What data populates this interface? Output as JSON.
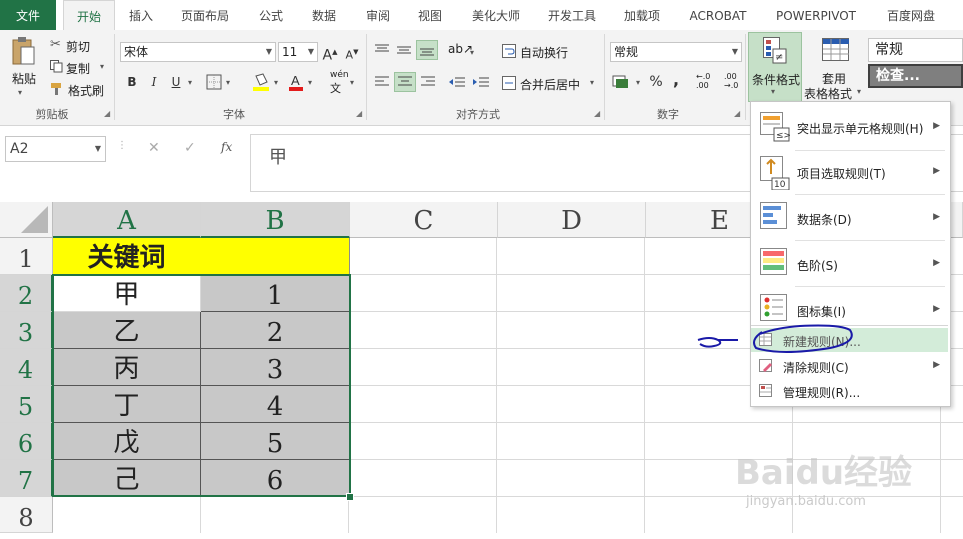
{
  "tabs": {
    "file": "文件",
    "home": "开始",
    "insert": "插入",
    "layout": "页面布局",
    "formulas": "公式",
    "data": "数据",
    "review": "审阅",
    "view": "视图",
    "beautify": "美化大师",
    "developer": "开发工具",
    "addins": "加载项",
    "acrobat": "ACROBAT",
    "powerpivot": "POWERPIVOT",
    "baidu": "百度网盘"
  },
  "clipboard": {
    "paste": "粘贴",
    "cut": "剪切",
    "copy": "复制",
    "format_painter": "格式刷",
    "group": "剪贴板"
  },
  "font": {
    "name": "宋体",
    "size": "11",
    "bold": "B",
    "italic": "I",
    "underline": "U",
    "phonetic": "wén",
    "group": "字体",
    "grow": "A",
    "shrink": "A"
  },
  "alignment": {
    "wrap": "自动换行",
    "merge": "合并后居中",
    "group": "对齐方式"
  },
  "number": {
    "format": "常规",
    "percent": "%",
    "comma": ",",
    "group": "数字",
    "inc": ".00",
    "dec": ".0"
  },
  "styles": {
    "cond_format": "条件格式",
    "table_format_1": "套用",
    "table_format_2": "表格格式",
    "style_normal": "常规",
    "style_check": "检查..."
  },
  "formula_bar": {
    "name_box": "A2",
    "fx": "fx",
    "value": "甲"
  },
  "columns": [
    "A",
    "B",
    "C",
    "D",
    "E"
  ],
  "rows": [
    "1",
    "2",
    "3",
    "4",
    "5",
    "6",
    "7",
    "8"
  ],
  "cells": {
    "a1": "关键词",
    "b1": "",
    "a": [
      "甲",
      "乙",
      "丙",
      "丁",
      "戊",
      "己"
    ],
    "b": [
      "1",
      "2",
      "3",
      "4",
      "5",
      "6"
    ]
  },
  "menu": {
    "highlight": "突出显示单元格规则(H)",
    "topbottom": "项目选取规则(T)",
    "databar": "数据条(D)",
    "colorscale": "色阶(S)",
    "iconset": "图标集(I)",
    "newrule": "新建规则(N)...",
    "clearrule": "清除规则(C)",
    "managerule": "管理规则(R)..."
  },
  "watermark": {
    "brand": "Baidu经验",
    "url": "jingyan.baidu.com"
  },
  "colors": {
    "excel_green": "#217346",
    "header_yellow": "#ffff00",
    "selection_gray": "#c8c8c8",
    "annotation_blue": "#1a1aa8"
  }
}
